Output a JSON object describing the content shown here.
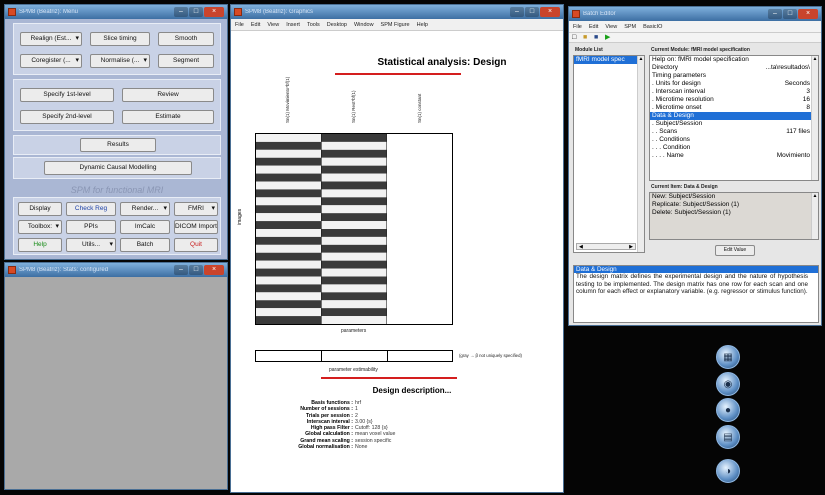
{
  "spm_menu": {
    "title": "SPM8 (Beatriz): Menu",
    "buttons": {
      "realign": "Realign (Est...",
      "slice_timing": "Slice timing",
      "smooth": "Smooth",
      "coregister": "Coregister (...",
      "normalise": "Normalise (...",
      "segment": "Segment",
      "specify_1st": "Specify 1st-level",
      "review": "Review",
      "specify_2nd": "Specify 2nd-level",
      "estimate": "Estimate",
      "results": "Results",
      "dcm": "Dynamic Causal Modelling",
      "display": "Display",
      "check_reg": "Check Reg",
      "render": "Render...",
      "modality": "FMRI",
      "toolbox": "Toolbox:",
      "ppis": "PPIs",
      "imcalc": "ImCalc",
      "dicom": "DICOM Import",
      "help": "Help",
      "utils": "Utils...",
      "batch": "Batch",
      "quit": "Quit"
    },
    "branding": "SPM for functional MRI"
  },
  "interactive": {
    "title": "SPM8 (Beatriz): Stats: configured"
  },
  "graphics": {
    "title": "SPM8 (Beatriz): Graphics",
    "menu": [
      "File",
      "Edit",
      "View",
      "Insert",
      "Tools",
      "Desktop",
      "Window",
      "SPM Figure",
      "Help"
    ],
    "heading": "Statistical analysis: Design",
    "columns": [
      "Sn(1) Movimiento*bf(1)",
      "Sn(1) Rest*bf(1)",
      "Sn(1) constant"
    ],
    "ylabel": "images",
    "xlabel": "parameters",
    "estimability_label": "parameter estimability",
    "estimability_note": "(gray → β not uniquely specified)",
    "desc_title": "Design description...",
    "description": [
      {
        "k": "Basis functions :",
        "v": "hrf"
      },
      {
        "k": "Number of sessions :",
        "v": "1"
      },
      {
        "k": "Trials per session :",
        "v": "2"
      },
      {
        "k": "Interscan interval :",
        "v": "3.00 {s}"
      },
      {
        "k": "High pass Filter :",
        "v": "Cutoff: 128 {s}"
      },
      {
        "k": "Global calculation :",
        "v": "mean voxel value"
      },
      {
        "k": "Grand mean scaling :",
        "v": "session specific"
      },
      {
        "k": "Global normalisation :",
        "v": "None"
      }
    ]
  },
  "batch": {
    "title": "Batch Editor",
    "menu": [
      "File",
      "Edit",
      "View",
      "SPM",
      "BasicIO"
    ],
    "module_list_header": "Module List",
    "modules": [
      "fMRI model spec"
    ],
    "current_module_header": "Current Module: fMRI model specification",
    "tree": [
      {
        "l": "Help on: fMRI model specification",
        "v": ""
      },
      {
        "l": "Directory",
        "v": "...ta\\resultados\\"
      },
      {
        "l": "Timing parameters",
        "v": ""
      },
      {
        "l": ". Units for design",
        "v": "Seconds"
      },
      {
        "l": ". Interscan interval",
        "v": "3"
      },
      {
        "l": ". Microtime resolution",
        "v": "16"
      },
      {
        "l": ". Microtime onset",
        "v": "8"
      },
      {
        "l": "Data & Design",
        "v": "",
        "sel": true
      },
      {
        "l": ". Subject/Session",
        "v": ""
      },
      {
        "l": ". . Scans",
        "v": "117 files"
      },
      {
        "l": ". . Conditions",
        "v": ""
      },
      {
        "l": ". . . Condition",
        "v": ""
      },
      {
        "l": ". . . . Name",
        "v": "Movimiento"
      }
    ],
    "current_item_header": "Current Item: Data & Design",
    "item_options": [
      "New: Subject/Session",
      "Replicate: Subject/Session (1)",
      "Delete: Subject/Session (1)"
    ],
    "edit_value": "Edit Value",
    "help_title": "Data & Design",
    "help_text": "The design matrix defines the experimental design and the nature of hypothesis testing to be implemented. The design matrix has one row for each scan and one column for each effect or explanatory variable. (e.g. regressor or stimulus function)."
  },
  "colors": {
    "title_bar": "#3d6fa3",
    "selection": "#1f6fd6",
    "spm_red": "#d41e1e",
    "spm_bg": "#aab7d4"
  }
}
